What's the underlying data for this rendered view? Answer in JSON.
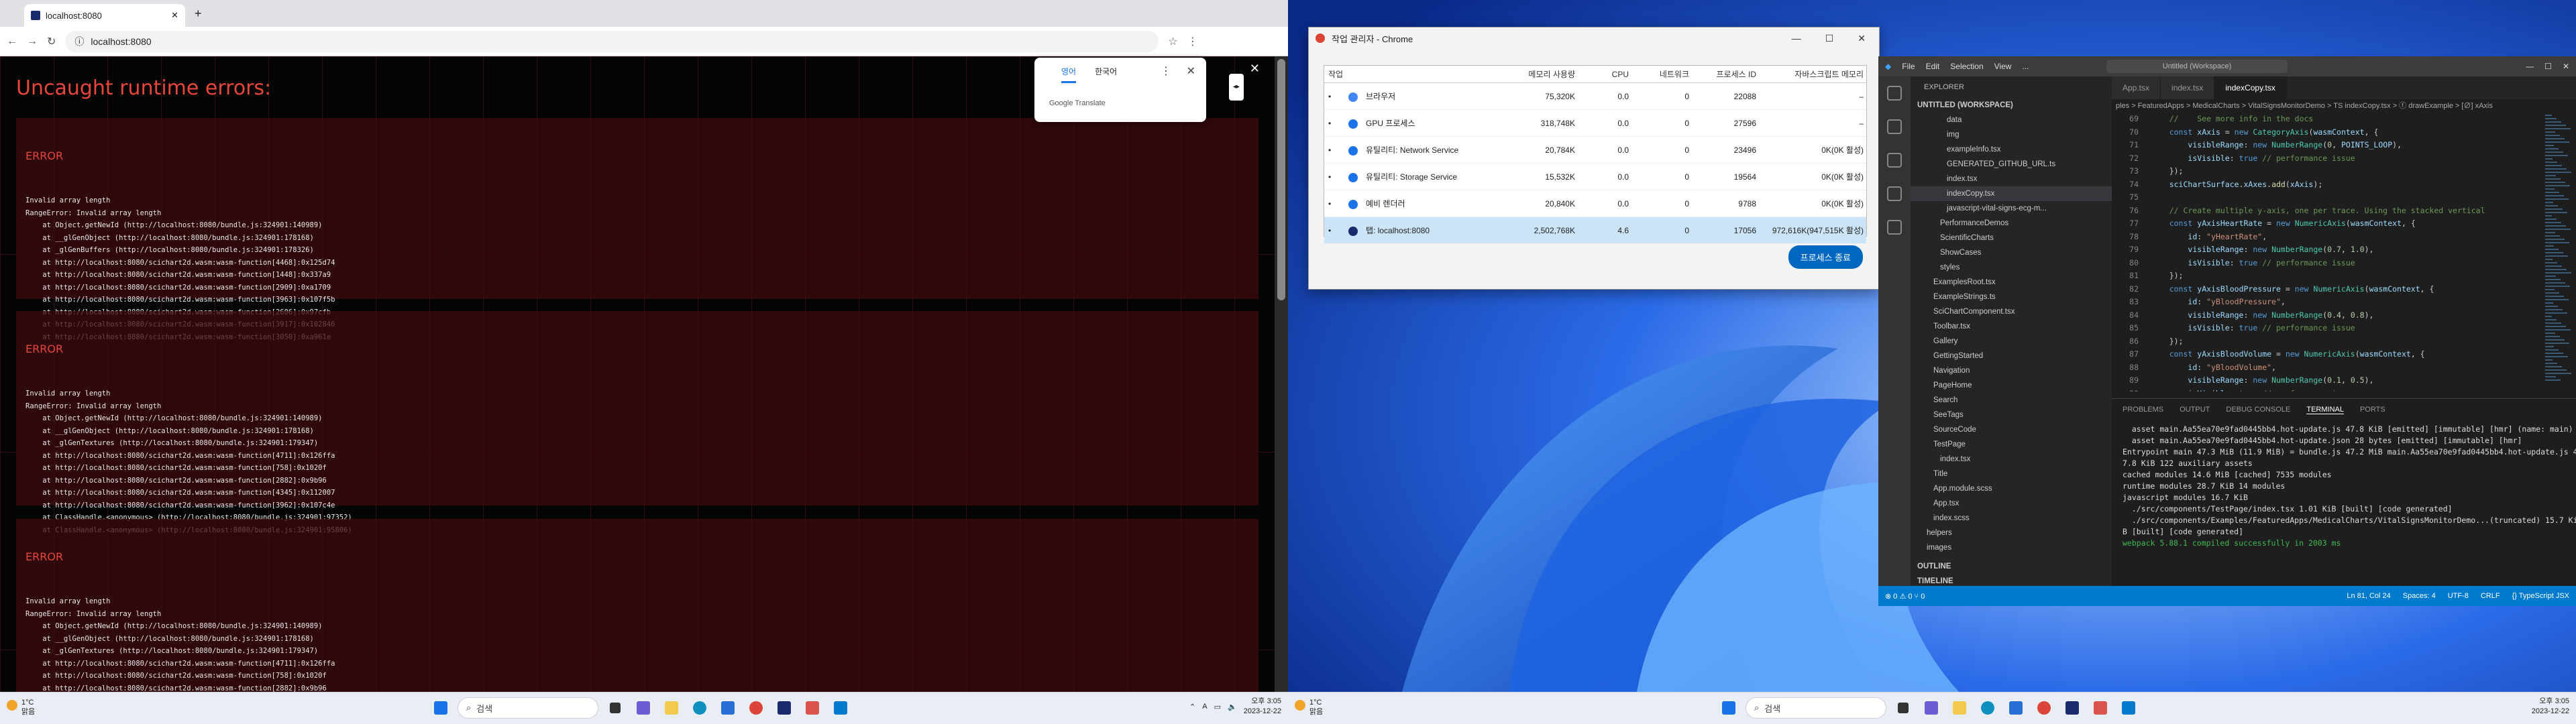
{
  "left": {
    "chrome": {
      "tab_title": "localhost:8080",
      "url": "localhost:8080"
    },
    "overlay": {
      "title": "Uncaught runtime errors:",
      "errors": [
        {
          "label": "ERROR",
          "text": "Invalid array length\nRangeError: Invalid array length\n    at Object.getNewId (http://localhost:8080/bundle.js:324901:140989)\n    at __glGenObject (http://localhost:8080/bundle.js:324901:178168)\n    at _glGenBuffers (http://localhost:8080/bundle.js:324901:178326)\n    at http://localhost:8080/scichart2d.wasm:wasm-function[4468]:0x125d74\n    at http://localhost:8080/scichart2d.wasm:wasm-function[1448]:0x337a9\n    at http://localhost:8080/scichart2d.wasm:wasm-function[2909]:0xa1709\n    at http://localhost:8080/scichart2d.wasm:wasm-function[3963]:0x107f5b\n    at http://localhost:8080/scichart2d.wasm:wasm-function[2606]:0x97cfb\n    at http://localhost:8080/scichart2d.wasm:wasm-function[3917]:0x102846\n    at http://localhost:8080/scichart2d.wasm:wasm-function[3050]:0xa961e"
        },
        {
          "label": "ERROR",
          "text": "Invalid array length\nRangeError: Invalid array length\n    at Object.getNewId (http://localhost:8080/bundle.js:324901:140989)\n    at __glGenObject (http://localhost:8080/bundle.js:324901:178168)\n    at _glGenTextures (http://localhost:8080/bundle.js:324901:179347)\n    at http://localhost:8080/scichart2d.wasm:wasm-function[4711]:0x126ffa\n    at http://localhost:8080/scichart2d.wasm:wasm-function[758]:0x1020f\n    at http://localhost:8080/scichart2d.wasm:wasm-function[2882]:0x9b96\n    at http://localhost:8080/scichart2d.wasm:wasm-function[4345]:0x112007\n    at http://localhost:8080/scichart2d.wasm:wasm-function[3962]:0x107c4e\n    at ClassHandle.<anonymous> (http://localhost:8080/bundle.js:324901:97352)\n    at ClassHandle.<anonymous> (http://localhost:8080/bundle.js:324901:95806)"
        },
        {
          "label": "ERROR",
          "text": "Invalid array length\nRangeError: Invalid array length\n    at Object.getNewId (http://localhost:8080/bundle.js:324901:140989)\n    at __glGenObject (http://localhost:8080/bundle.js:324901:178168)\n    at _glGenTextures (http://localhost:8080/bundle.js:324901:179347)\n    at http://localhost:8080/scichart2d.wasm:wasm-function[4711]:0x126ffa\n    at http://localhost:8080/scichart2d.wasm:wasm-function[758]:0x1020f\n    at http://localhost:8080/scichart2d.wasm:wasm-function[2882]:0x9b96\n    at http://localhost:8080/scichart2d.wasm:wasm-function[4345]:0x112007\n    at http://localhost:8080/scichart2d.wasm:wasm-function[3962]:0x107c4e\n    at ClassHandle.<anonymous> (http://localhost:8080/bundle.js:324901:97352)\n    at ClassHandle.<anonymous> (http://localhost:8080/bundle.js:324901:95806)"
        }
      ]
    },
    "translate": {
      "tab1": "영어",
      "tab2": "한국어",
      "footer": "Google Translate"
    },
    "taskbar": {
      "weather_temp": "1°C",
      "weather_desc": "맑음",
      "search": "검색",
      "time": "오후 3:05",
      "date": "2023-12-22"
    }
  },
  "right": {
    "taskmgr": {
      "title": "작업 관리자 - Chrome",
      "headers": [
        "작업",
        "메모리 사용량",
        "CPU",
        "네트워크",
        "프로세스 ID",
        "자바스크립트 메모리"
      ],
      "rows": [
        {
          "name": "브라우저",
          "mem": "75,320K",
          "cpu": "0.0",
          "net": "0",
          "pid": "22088",
          "js": "–",
          "color": "#4285f4"
        },
        {
          "name": "GPU 프로세스",
          "mem": "318,748K",
          "cpu": "0.0",
          "net": "0",
          "pid": "27596",
          "js": "–",
          "color": "#1a73e8"
        },
        {
          "name": "유틸리티: Network Service",
          "mem": "20,784K",
          "cpu": "0.0",
          "net": "0",
          "pid": "23496",
          "js": "0K(0K 활성)",
          "color": "#1a73e8"
        },
        {
          "name": "유틸리티: Storage Service",
          "mem": "15,532K",
          "cpu": "0.0",
          "net": "0",
          "pid": "19564",
          "js": "0K(0K 활성)",
          "color": "#1a73e8"
        },
        {
          "name": "예비 렌더러",
          "mem": "20,840K",
          "cpu": "0.0",
          "net": "0",
          "pid": "9788",
          "js": "0K(0K 활성)",
          "color": "#1a73e8"
        },
        {
          "name": "탭: localhost:8080",
          "mem": "2,502,768K",
          "cpu": "4.6",
          "net": "0",
          "pid": "17056",
          "js": "972,616K(947,515K 활성)",
          "color": "#1a2b6d"
        }
      ],
      "end_button": "프로세스 종료"
    },
    "vscode": {
      "menu": [
        "File",
        "Edit",
        "Selection",
        "View",
        "..."
      ],
      "command": "Untitled (Workspace)",
      "explorer_title": "EXPLORER",
      "workspace": "UNTITLED (WORKSPACE)",
      "tree": [
        "data",
        "img",
        "exampleInfo.tsx",
        "GENERATED_GITHUB_URL.ts",
        "index.tsx",
        "indexCopy.tsx",
        "javascript-vital-signs-ecg-m...",
        "PerformanceDemos",
        "ScientificCharts",
        "ShowCases",
        "styles",
        "ExamplesRoot.tsx",
        "ExampleStrings.ts",
        "SciChartComponent.tsx",
        "Toolbar.tsx",
        "Gallery",
        "GettingStarted",
        "Navigation",
        "PageHome",
        "Search",
        "SeeTags",
        "SourceCode",
        "TestPage",
        "index.tsx",
        "Title",
        "App.module.scss",
        "App.tsx",
        "index.scss",
        "helpers",
        "images"
      ],
      "outline": "OUTLINE",
      "timeline": "TIMELINE",
      "tabs": [
        "App.tsx",
        "index.tsx",
        "indexCopy.tsx"
      ],
      "breadcrumb": "ples > FeaturedApps > MedicalCharts > VitalSignsMonitorDemo > TS indexCopy.tsx > ⓕ drawExample > [∅] xAxis",
      "panel_tabs": [
        "PROBLEMS",
        "OUTPUT",
        "DEBUG CONSOLE",
        "TERMINAL",
        "PORTS"
      ],
      "terminal": [
        "  asset main.Aa55ea70e9fad0445bb4.hot-update.js 47.8 KiB [emitted] [immutable] [hmr] (name: main)",
        "  asset main.Aa55ea70e9fad0445bb4.hot-update.json 28 bytes [emitted] [immutable] [hmr]",
        "Entrypoint main 47.3 MiB (11.9 MiB) = bundle.js 47.2 MiB main.Aa55ea70e9fad0445bb4.hot-update.js 4",
        "7.8 KiB 122 auxiliary assets",
        "cached modules 14.6 MiB [cached] 7535 modules",
        "runtime modules 28.7 KiB 14 modules",
        "javascript modules 16.7 KiB",
        "  ./src/components/TestPage/index.tsx 1.01 KiB [built] [code generated]",
        "  ./src/components/Examples/FeaturedApps/MedicalCharts/VitalSignsMonitorDemo...(truncated) 15.7 Ki",
        "B [built] [code generated]",
        "webpack 5.88.1 compiled successfully in 2003 ms"
      ],
      "status_left": "⊗ 0 ⚠ 0   ⑂ 0",
      "status_right": [
        "Ln 81, Col 24",
        "Spaces: 4",
        "UTF-8",
        "CRLF",
        "{} TypeScript JSX"
      ]
    },
    "taskbar": {
      "weather_temp": "1°C",
      "weather_desc": "맑음",
      "search": "검색",
      "time": "오후 3:05",
      "date": "2023-12-22"
    }
  }
}
